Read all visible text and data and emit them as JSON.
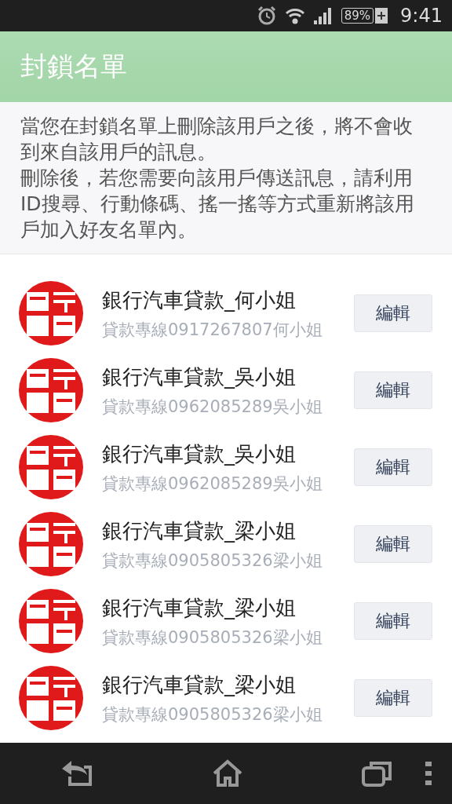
{
  "status_bar": {
    "battery": "89%",
    "time": "9:41"
  },
  "app_bar": {
    "title": "封鎖名單"
  },
  "notice": [
    "當您在封鎖名單上刪除該用戶之後，將不會收到來自該用戶的訊息。",
    "刪除後，若您需要向該用戶傳送訊息，請利用ID搜尋、行動條碼、搖一搖等方式重新將該用戶加入好友名單內。"
  ],
  "contacts": [
    {
      "name": "銀行汽車貸款_何小姐",
      "status": "貸款專線0917267807何小姐",
      "button": "編輯"
    },
    {
      "name": "銀行汽車貸款_吳小姐",
      "status": "貸款專線0962085289吳小姐",
      "button": "編輯"
    },
    {
      "name": "銀行汽車貸款_吳小姐",
      "status": "貸款專線0962085289吳小姐",
      "button": "編輯"
    },
    {
      "name": "銀行汽車貸款_梁小姐",
      "status": "貸款專線0905805326梁小姐",
      "button": "編輯"
    },
    {
      "name": "銀行汽車貸款_梁小姐",
      "status": "貸款專線0905805326梁小姐",
      "button": "編輯"
    },
    {
      "name": "銀行汽車貸款_梁小姐",
      "status": "貸款專線0905805326梁小姐",
      "button": "編輯"
    }
  ]
}
